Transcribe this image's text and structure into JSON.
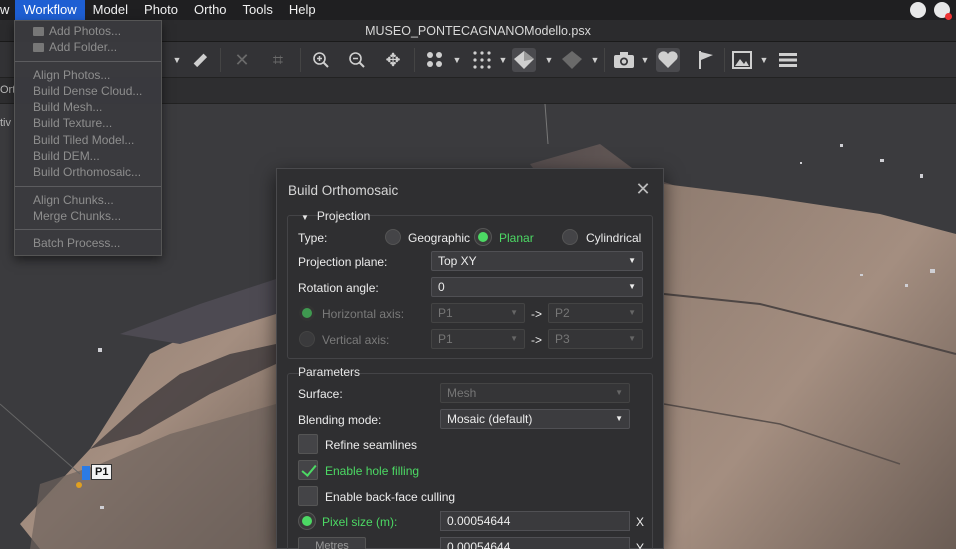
{
  "menubar": {
    "edge": "w",
    "items": [
      "Workflow",
      "Model",
      "Photo",
      "Ortho",
      "Tools",
      "Help"
    ],
    "active": "Workflow"
  },
  "window": {
    "title": "MUSEO_PONTECAGNANOModello.psx"
  },
  "left_panel": {
    "tab_fragment": "Ort",
    "label_fragment": "tiv"
  },
  "workflow_menu": {
    "items": [
      {
        "label": "Add Photos...",
        "enabled": false,
        "icon": "photos-icon"
      },
      {
        "label": "Add Folder...",
        "enabled": false,
        "icon": "folder-icon"
      },
      {
        "separator": true
      },
      {
        "label": "Align Photos...",
        "enabled": false
      },
      {
        "label": "Build Dense Cloud...",
        "enabled": false
      },
      {
        "label": "Build Mesh...",
        "enabled": false
      },
      {
        "label": "Build Texture...",
        "enabled": false
      },
      {
        "label": "Build Tiled Model...",
        "enabled": false
      },
      {
        "label": "Build DEM...",
        "enabled": false
      },
      {
        "label": "Build Orthomosaic...",
        "enabled": false
      },
      {
        "separator": true
      },
      {
        "label": "Align Chunks...",
        "enabled": false
      },
      {
        "label": "Merge Chunks...",
        "enabled": false
      },
      {
        "separator": true
      },
      {
        "label": "Batch Process...",
        "enabled": false
      }
    ]
  },
  "toolbar": {
    "icons": [
      "ruler-icon",
      "delete-icon",
      "crop-icon",
      "zoom-in-icon",
      "zoom-out-icon",
      "move-icon",
      "point-cloud-icon",
      "dense-cloud-icon",
      "mesh-shaded-icon",
      "mesh-textured-icon",
      "camera-icon",
      "heart-icon",
      "flag-icon",
      "image-icon",
      "layers-icon"
    ]
  },
  "viewport": {
    "marker_label": "P1"
  },
  "dialog": {
    "title": "Build Orthomosaic",
    "projection": {
      "section_label": "Projection",
      "type_label": "Type:",
      "types": [
        "Geographic",
        "Planar",
        "Cylindrical"
      ],
      "selected_type": "Planar",
      "plane_label": "Projection plane:",
      "plane_value": "Top XY",
      "rotation_label": "Rotation angle:",
      "rotation_value": "0",
      "h_axis_label": "Horizontal axis:",
      "h_axis_from": "P1",
      "h_axis_to": "P2",
      "v_axis_label": "Vertical axis:",
      "v_axis_from": "P1",
      "v_axis_to": "P3",
      "arrow": "->"
    },
    "parameters": {
      "section_label": "Parameters",
      "surface_label": "Surface:",
      "surface_value": "Mesh",
      "blending_label": "Blending mode:",
      "blending_value": "Mosaic (default)",
      "refine_label": "Refine seamlines",
      "refine_checked": false,
      "hole_label": "Enable hole filling",
      "hole_checked": true,
      "backface_label": "Enable back-face culling",
      "backface_checked": false,
      "pixel_label": "Pixel size (m):",
      "pixel_x": "0.00054644",
      "pixel_y": "0.00054644",
      "x_label": "X",
      "y_label": "Y",
      "units_button": "Metres"
    }
  },
  "colors": {
    "accent_green": "#4cd964",
    "menu_highlight": "#1e5fd3",
    "marker_blue": "#2c7be5"
  }
}
